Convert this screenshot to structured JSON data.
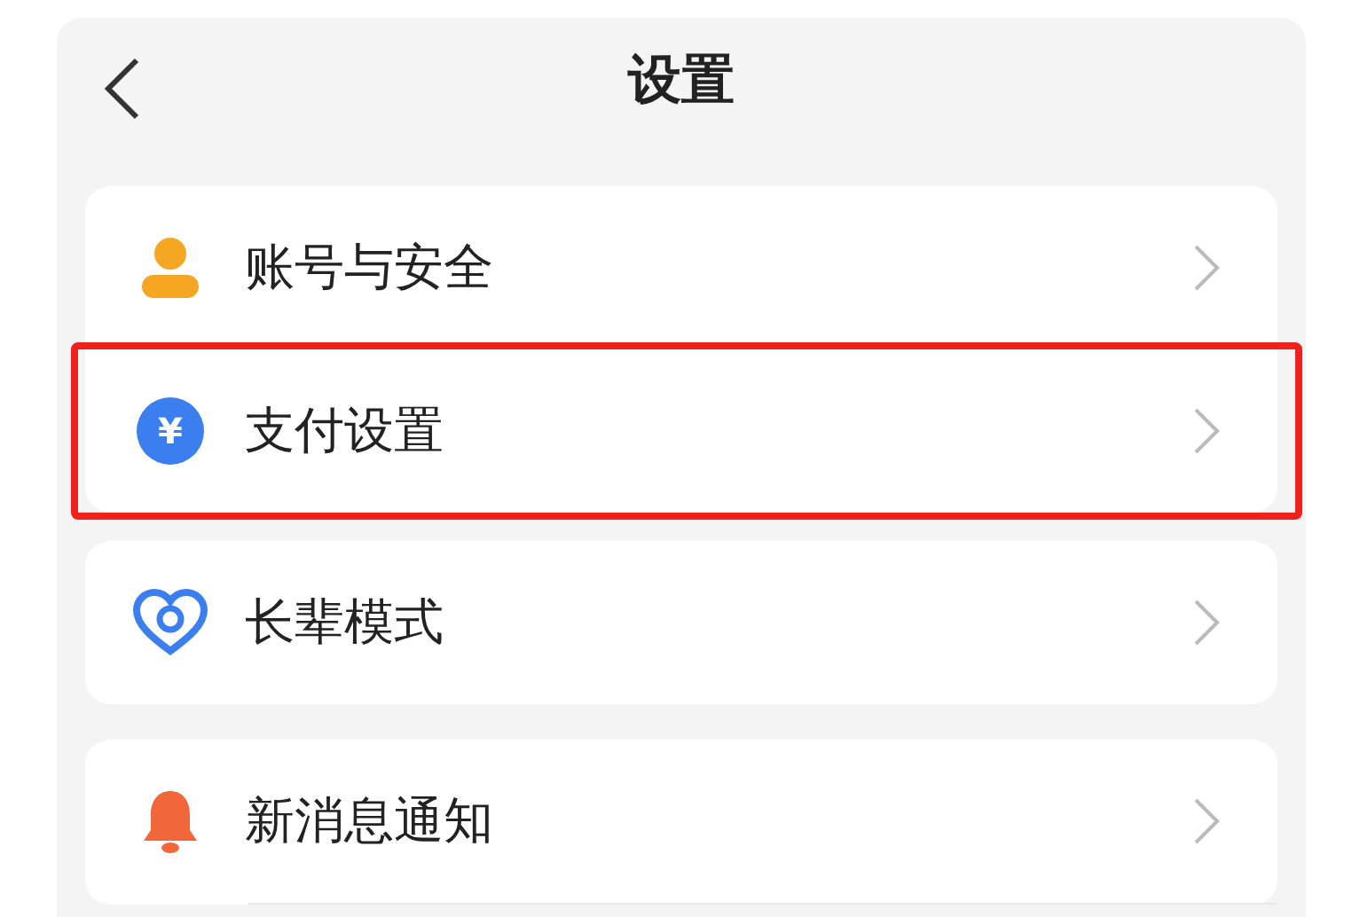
{
  "header": {
    "title": "设置"
  },
  "groups": [
    {
      "items": [
        {
          "kind": "person",
          "label": "账号与安全",
          "highlighted": false
        },
        {
          "kind": "yuan",
          "badge": "¥",
          "label": "支付设置",
          "highlighted": true
        }
      ]
    },
    {
      "items": [
        {
          "kind": "heart",
          "label": "长辈模式",
          "highlighted": false
        }
      ]
    },
    {
      "items": [
        {
          "kind": "bell",
          "label": "新消息通知",
          "highlighted": false
        }
      ]
    }
  ]
}
